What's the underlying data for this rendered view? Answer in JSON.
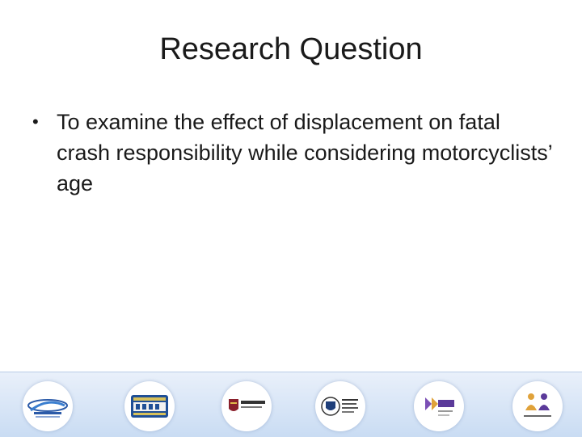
{
  "slide": {
    "title": "Research Question",
    "bullets": [
      {
        "symbol": "•",
        "text": "To examine the effect of displacement on fatal crash responsibility while considering motorcyclists’ age"
      }
    ]
  },
  "footer": {
    "logos": [
      {
        "name": "astro21-logo"
      },
      {
        "name": "crsd-logo"
      },
      {
        "name": "lakehead-logo"
      },
      {
        "name": "university-crest-logo"
      },
      {
        "name": "cahr-logo"
      },
      {
        "name": "people-figures-logo"
      }
    ]
  }
}
